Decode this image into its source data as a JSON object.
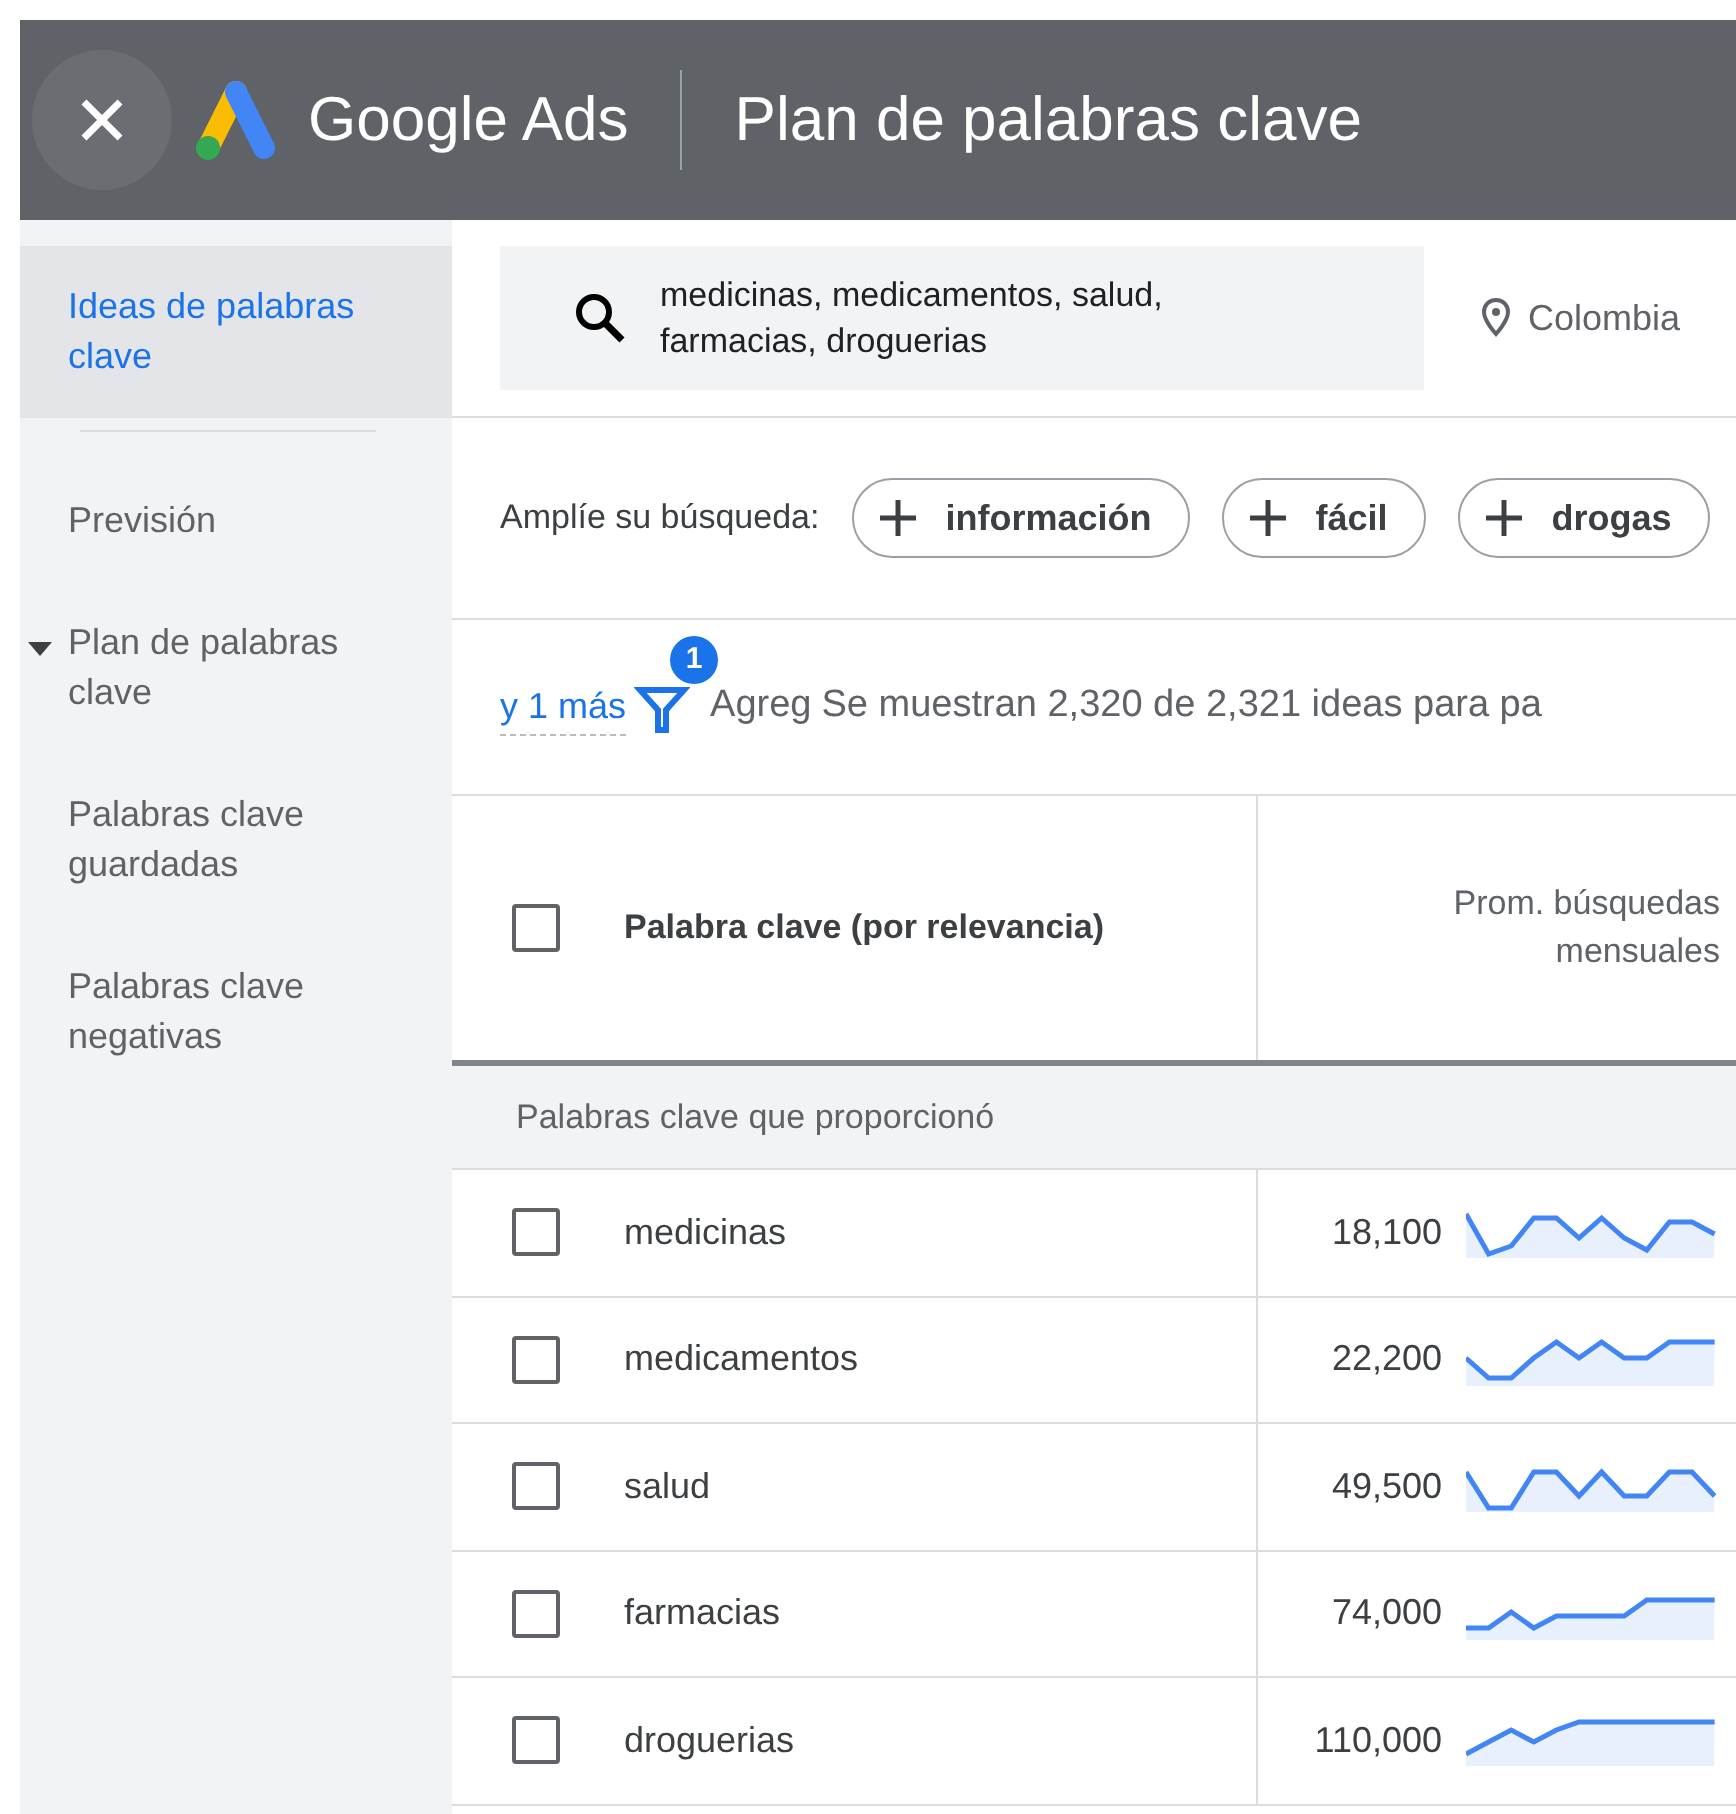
{
  "header": {
    "brand": "Google Ads",
    "title": "Plan de palabras clave"
  },
  "sidebar": {
    "items": [
      {
        "label": "Ideas de palabras clave",
        "selected": true,
        "kind": "link"
      },
      {
        "label": "Previsión",
        "selected": false,
        "kind": "link"
      },
      {
        "label": "Plan de palabras clave",
        "selected": false,
        "kind": "group"
      },
      {
        "label": "Palabras clave guardadas",
        "selected": false,
        "kind": "link"
      },
      {
        "label": "Palabras clave negativas",
        "selected": false,
        "kind": "link"
      }
    ]
  },
  "search": {
    "value": "medicinas, medicamentos, salud, farmacias, droguerias",
    "location": "Colombia"
  },
  "broaden": {
    "label": "Amplíe su búsqueda:",
    "chips": [
      "información",
      "fácil",
      "drogas"
    ]
  },
  "filters": {
    "more_link": "y 1 más",
    "badge": "1",
    "add_filter": "Agreg",
    "summary": "Se muestran 2,320 de 2,321 ideas para pa"
  },
  "table": {
    "columns": [
      "Palabra clave (por relevancia)",
      "Prom. búsquedas mensuales"
    ],
    "header_checked": false,
    "group": "Palabras clave que proporcionó",
    "rows": [
      {
        "keyword": "medicinas",
        "searches": "18,100",
        "checked": false
      },
      {
        "keyword": "medicamentos",
        "searches": "22,200",
        "checked": false
      },
      {
        "keyword": "salud",
        "searches": "49,500",
        "checked": false
      },
      {
        "keyword": "farmacias",
        "searches": "74,000",
        "checked": false
      },
      {
        "keyword": "droguerias",
        "searches": "110,000",
        "checked": false
      }
    ]
  }
}
